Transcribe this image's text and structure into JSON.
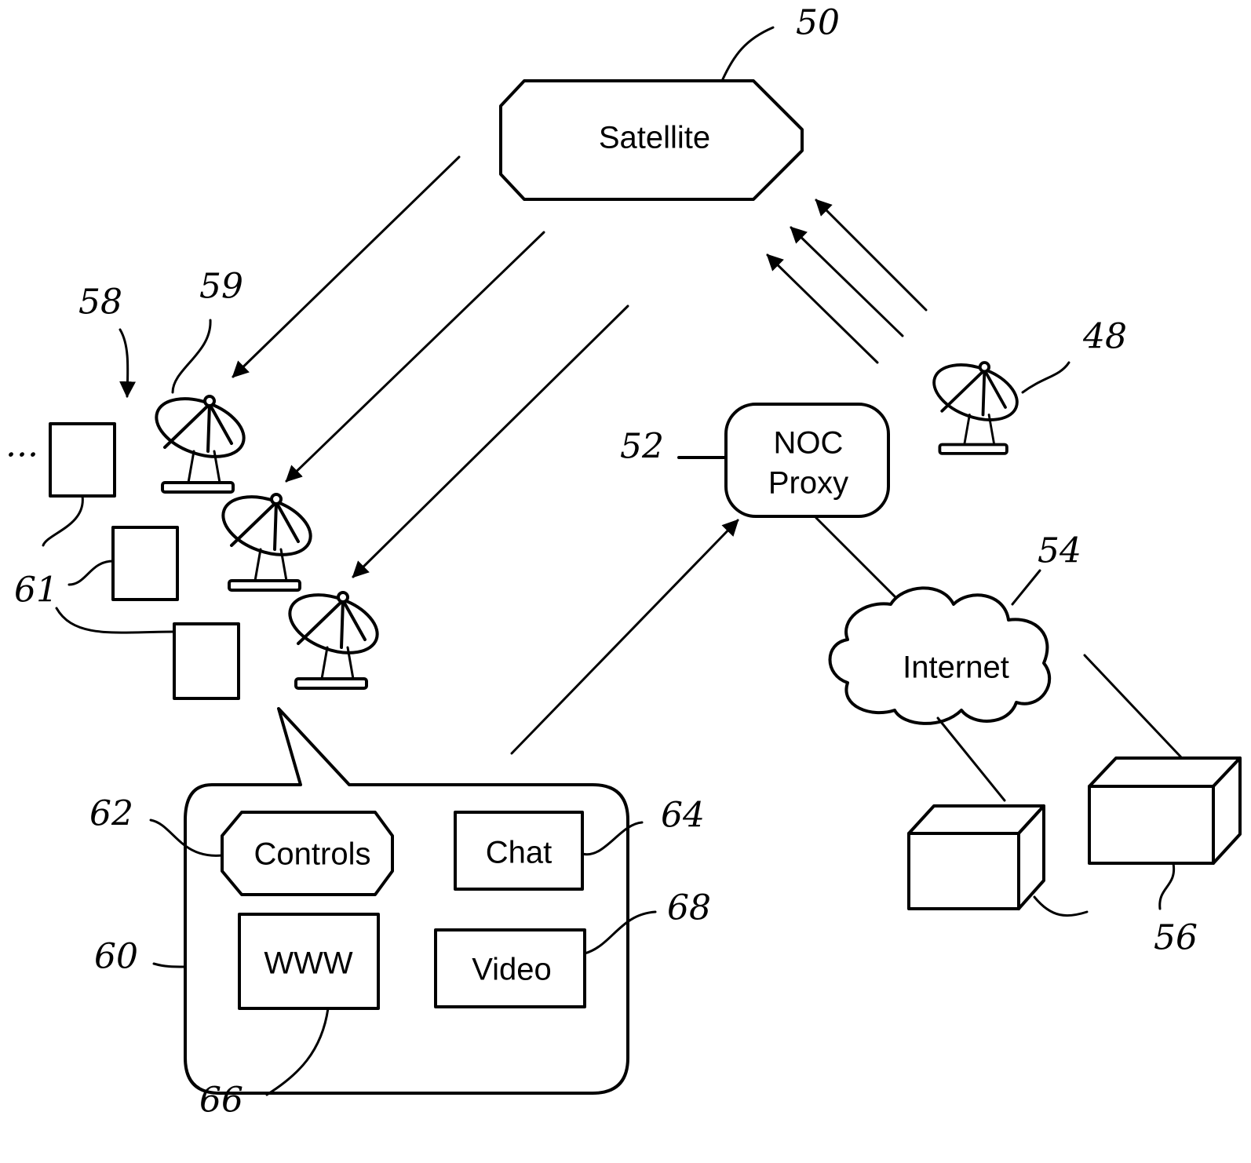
{
  "diagram": {
    "nodes": {
      "satellite": {
        "label": "Satellite",
        "ref": "50"
      },
      "noc_proxy": {
        "label_line1": "NOC",
        "label_line2": "Proxy",
        "ref": "52"
      },
      "internet": {
        "label": "Internet",
        "ref": "54"
      },
      "servers": {
        "ref": "56"
      },
      "uplink_dish": {
        "ref": "48"
      },
      "user_sites": {
        "ref": "58"
      },
      "user_dish": {
        "ref": "59"
      },
      "user_terminals": {
        "ref": "61"
      },
      "ui_panel": {
        "ref": "60"
      },
      "controls": {
        "label": "Controls",
        "ref": "62"
      },
      "chat": {
        "label": "Chat",
        "ref": "64"
      },
      "www": {
        "label": "WWW",
        "ref": "66"
      },
      "video": {
        "label": "Video",
        "ref": "68"
      }
    },
    "continuation_marker": "..."
  }
}
